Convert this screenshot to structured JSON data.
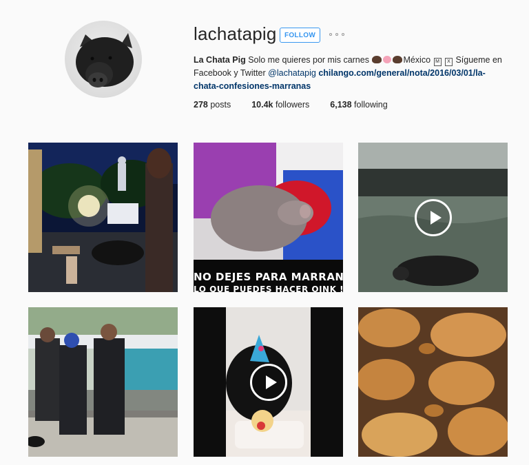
{
  "profile": {
    "username": "lachatapig",
    "follow_label": "FOLLOW",
    "more_icon": "ellipsis-icon",
    "bio": {
      "name": "La Chata Pig",
      "text1": " Solo me quieres por mis carnes ",
      "text2": "México ",
      "text3": " Sígueme en Facebook y Twitter ",
      "handle": "@lachatapig",
      "link": "chilango.com/general/nota/2016/03/01/la-chata-confesiones-marranas",
      "emoji_box_m": "M",
      "emoji_box_x": "X"
    },
    "stats": {
      "posts_count": "278",
      "posts_label": " posts",
      "followers_count": "10.4k",
      "followers_label": " followers",
      "following_count": "6,138",
      "following_label": " following"
    }
  },
  "posts": [
    {
      "kind": "photo",
      "icon": ""
    },
    {
      "kind": "photo",
      "caption_line1": "NO DEJES PARA MARRANA...",
      "caption_line2": "LO QUE PUEDES HACER OINK !"
    },
    {
      "kind": "video",
      "icon": "play-icon"
    },
    {
      "kind": "photo",
      "icon": ""
    },
    {
      "kind": "video",
      "icon": "play-icon"
    },
    {
      "kind": "photo",
      "icon": ""
    }
  ],
  "colors": {
    "accent": "#3897f0",
    "link": "#003569",
    "background": "#fafafa"
  }
}
